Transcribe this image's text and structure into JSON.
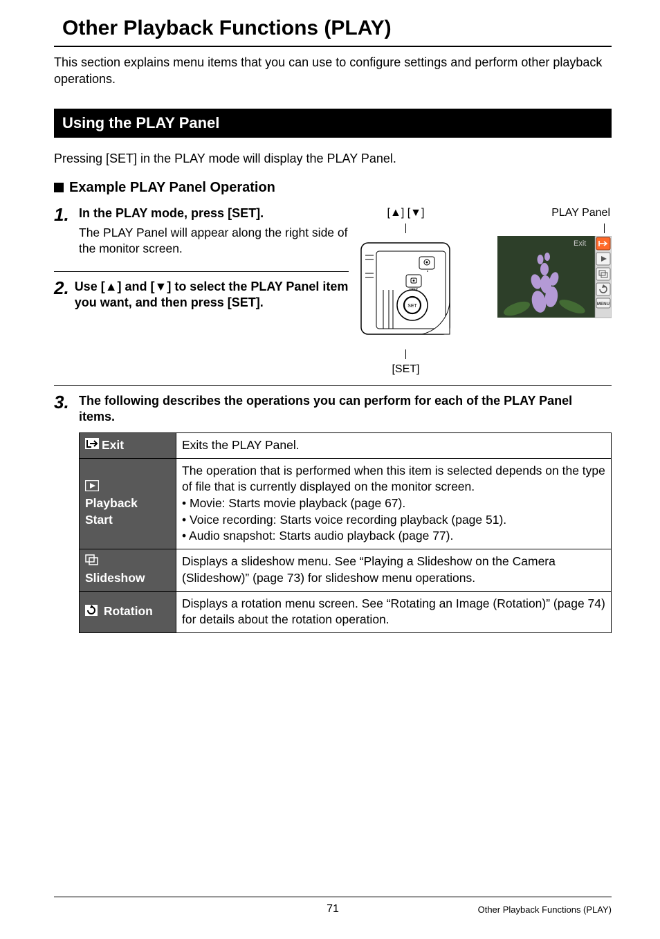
{
  "title": "Other Playback Functions (PLAY)",
  "intro": "This section explains menu items that you can use to configure settings and perform other playback operations.",
  "section_bar": "Using the PLAY Panel",
  "pressing_text": "Pressing [SET] in the PLAY mode will display the PLAY Panel.",
  "sub_heading": "Example PLAY Panel Operation",
  "steps": {
    "s1_title": "In the PLAY mode, press [SET].",
    "s1_body": "The PLAY Panel will appear along the right side of the monitor screen.",
    "s2_title": "Use [▲] and [▼] to select the PLAY Panel item you want, and then press [SET].",
    "s3_title": "The following describes the operations you can perform for each of the PLAY Panel items."
  },
  "fig_labels": {
    "arrows": "[▲] [▼]",
    "set": "[SET]",
    "play_panel": "PLAY Panel",
    "exit_txt": "Exit",
    "menu_txt": "MENU"
  },
  "table": {
    "exit_label": "Exit",
    "exit_desc": "Exits the PLAY Panel.",
    "pb_label1": "Playback",
    "pb_label2": "Start",
    "pb_intro": "The operation that is performed when this item is selected depends on the type of file that is currently displayed on the monitor screen.",
    "pb_b1": "Movie: Starts movie playback (page 67).",
    "pb_b2": "Voice recording: Starts voice recording playback (page 51).",
    "pb_b3": "Audio snapshot: Starts audio playback (page 77).",
    "ss_label": "Slideshow",
    "ss_desc": "Displays a slideshow menu. See “Playing a Slideshow on the Camera (Slideshow)” (page 73) for slideshow menu operations.",
    "rot_label": "Rotation",
    "rot_desc": "Displays a rotation menu screen. See “Rotating an Image (Rotation)” (page 74) for details about the rotation operation."
  },
  "footer": {
    "page": "71",
    "section": "Other Playback Functions (PLAY)"
  }
}
